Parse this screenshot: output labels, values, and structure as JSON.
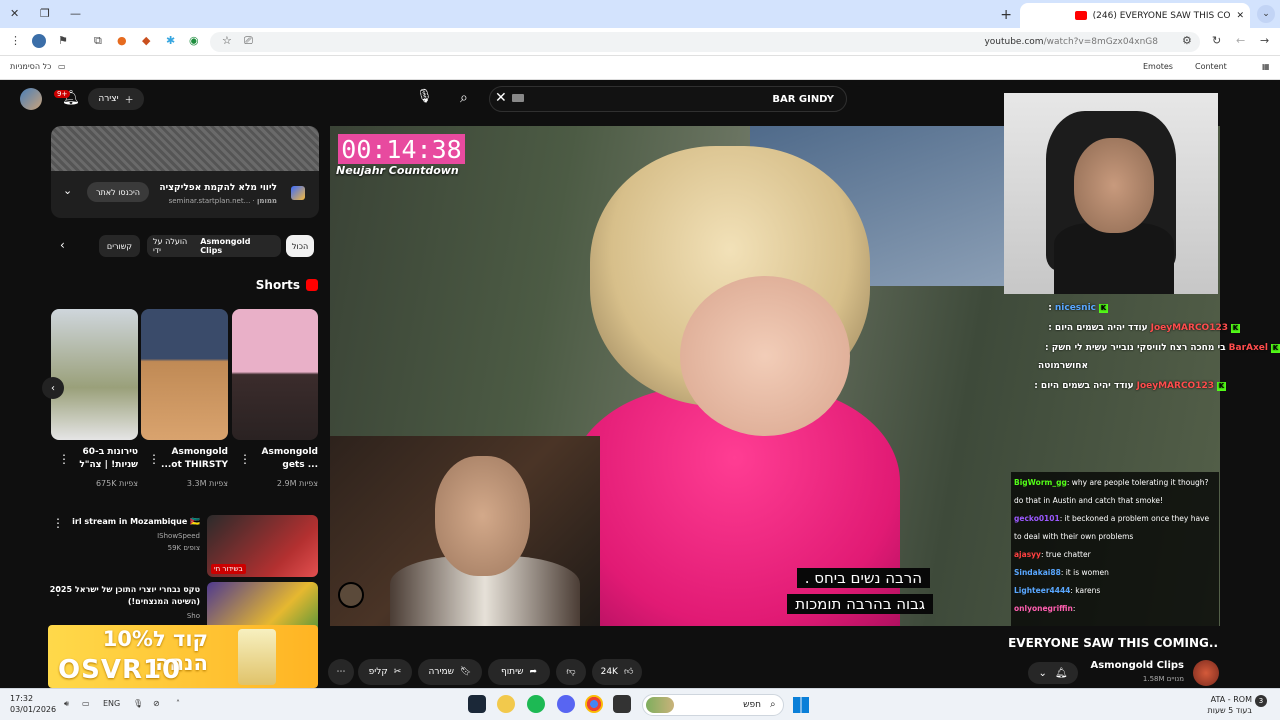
{
  "browser": {
    "tab_title": "(246) EVERYONE SAW THIS CO",
    "url_host": "youtube.com",
    "url_path": "/watch?v=8mGzx04xnG8",
    "bookmarks": {
      "all": "כל הסימניות",
      "emotes": "Emotes",
      "content": "Content"
    }
  },
  "header": {
    "create_label": "יצירה",
    "notif_count": "9+",
    "search_value": "BAR GINDY"
  },
  "ad": {
    "title": "ליווי מלא להקמת אפליקציה",
    "sponsor": "ממומן",
    "domain": "seminar.startplan.net...",
    "cta": "היכנסו לאתר"
  },
  "chips": {
    "all": "הכול",
    "uploaded_by": "הועלה על ידי",
    "channel": "Asmongold Clips",
    "related": "קשורים"
  },
  "shorts": {
    "heading": "Shorts",
    "items": [
      {
        "title_l1": "טירונות ב-60",
        "title_l2": "שניות! | צה\"ל",
        "views": "675K צפיות"
      },
      {
        "title_l1": "Asmongold",
        "title_l2": "...ot THIRSTY",
        "views": "3.3M צפיות"
      },
      {
        "title_l1": "Asmongold",
        "title_l2": "gets ...",
        "views": "2.9M צפיות"
      }
    ]
  },
  "related": [
    {
      "title": "irl stream in Mozambique 🇲🇿",
      "channel": "IShowSpeed",
      "meta": "59K צופים",
      "badge": "בשידור חי"
    },
    {
      "title": "טקס נבחרי יוצרי התוכן של ישראל 2025 (השיטה המנצחים!)",
      "channel": "Sho",
      "meta": ""
    }
  ],
  "promo": {
    "line1": "קוד ל10% הנחה",
    "line2": "OSVR10"
  },
  "video": {
    "timer": "00:14:38",
    "timer_sub": "Neujahr Countdown",
    "caption_l1": "הרבה נשים ביחס .",
    "caption_l2": "גבוה בהרבה תומכות",
    "title": "EVERYONE SAW THIS COMING..",
    "channel": "Asmongold Clips",
    "subs": "1.58M מנויים",
    "likes": "24K",
    "share": "שיתוף",
    "save": "שמירה",
    "clip": "קליפ"
  },
  "kick_chat": [
    {
      "user": "nicesnic",
      "msg": ":"
    },
    {
      "user": "JoeyMARCO123",
      "msg": ": עודד יהיה בשמים היום"
    },
    {
      "user": "BarAxel",
      "msg": ": בי מחכה רצח לוויסקי נובייר עשית לי חשק"
    },
    {
      "user": "",
      "msg": "אחושרמוטה"
    },
    {
      "user": "JoeyMARCO123",
      "msg": ": עודד יהיה בשמים היום"
    }
  ],
  "twitch_chat": [
    {
      "user": "BigWorm_gg",
      "color": "#53fc18",
      "msg": ": why are people tolerating it though? do that in Austin and catch that smoke!"
    },
    {
      "user": "gecko0101",
      "color": "#9b59ff",
      "msg": ": it beckoned a problem once they have to deal with their own problems"
    },
    {
      "user": "ajasyy",
      "color": "#ff4040",
      "msg": ": true chatter"
    },
    {
      "user": "Sindakai88",
      "color": "#59a7ff",
      "msg": ": it is women"
    },
    {
      "user": "Lighteer4444",
      "color": "#59a7ff",
      "msg": ": karens"
    },
    {
      "user": "onlyonegriffin",
      "color": "#ff5fb0",
      "msg": ":"
    }
  ],
  "taskbar": {
    "time": "17:32",
    "date": "03/01/2026",
    "lang": "ENG",
    "search": "חפש",
    "weather_l1": "ATA - ROM",
    "weather_l2": "בעוד 5 שעות",
    "weather_badge": "3"
  }
}
